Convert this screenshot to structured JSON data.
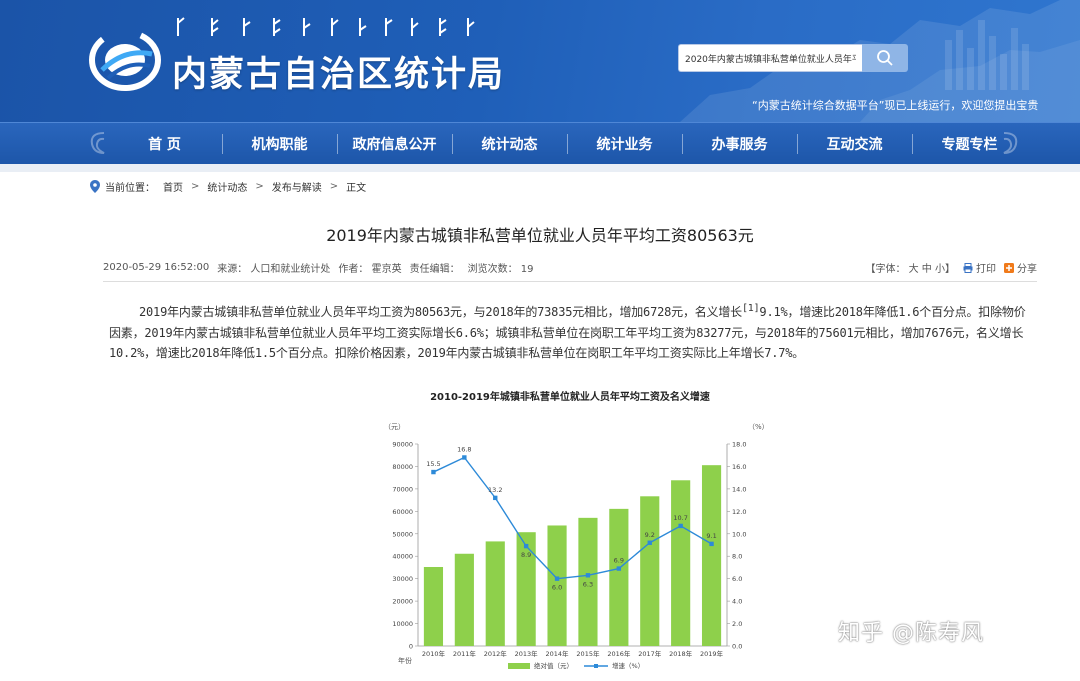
{
  "header": {
    "site_title": "内蒙古自治区统计局",
    "search_value": "2020年内蒙古城镇非私营单位就业人员年平",
    "marquee": "“内蒙古统计综合数据平台”现已上线运行，欢迎您提出宝贵"
  },
  "nav": [
    "首  页",
    "机构职能",
    "政府信息公开",
    "统计动态",
    "统计业务",
    "办事服务",
    "互动交流",
    "专题专栏"
  ],
  "breadcrumb": {
    "label": "当前位置：",
    "items": [
      "首页",
      "统计动态",
      "发布与解读",
      "正文"
    ],
    "sep": ">"
  },
  "article": {
    "title": "2019年内蒙古城镇非私营单位就业人员年平均工资80563元",
    "date": "2020-05-29 16:52:00",
    "source": "来源：  人口和就业统计处",
    "author": "作者：   霍京英",
    "editor": "责任编辑：",
    "views": "浏览次数：  19",
    "font_label": "【字体：  大  中  小】",
    "print_label": "打印",
    "share_label": "分享",
    "para_part1": "2019年内蒙古城镇非私营单位就业人员年平均工资为80563元，与2018年的73835元相比，增加6728元，名义增长",
    "footnote": "[1]",
    "para_part2": "9.1%，增速比2018年降低1.6个百分点。扣除物价因素，2019年内蒙古城镇非私营单位就业人员年平均工资实际增长6.6%；城镇非私营单位在岗职工年平均工资为83277元，与2018年的75601元相比，增加7676元，名义增长10.2%，增速比2018年降低1.5个百分点。扣除价格因素，2019年内蒙古城镇非私营单位在岗职工年平均工资实际比上年增长7.7%。"
  },
  "watermark": "知乎 @陈寿风",
  "colors": {
    "banner": "#1f5fb8",
    "nav": "#2a66bd",
    "bar": "#8ed04b",
    "line": "#2d8ad8"
  },
  "chart_data": {
    "type": "bar",
    "title": "2010-2019年城镇非私营单位就业人员年平均工资及名义增速",
    "categories": [
      "2010年",
      "2011年",
      "2012年",
      "2013年",
      "2014年",
      "2015年",
      "2016年",
      "2017年",
      "2018年",
      "2019年"
    ],
    "x_axis_label": "年份",
    "left_unit": "（元）",
    "right_unit": "（%）",
    "left_ylim": [
      0,
      90000
    ],
    "left_ticks": [
      0,
      10000,
      20000,
      30000,
      40000,
      50000,
      60000,
      70000,
      80000,
      90000
    ],
    "right_ylim": [
      0,
      18
    ],
    "right_ticks": [
      "0.0",
      "2.0",
      "4.0",
      "6.0",
      "8.0",
      "10.0",
      "12.0",
      "14.0",
      "16.0",
      "18.0"
    ],
    "series": [
      {
        "name": "绝对值（元）",
        "type": "bar",
        "values": [
          35200,
          41100,
          46600,
          50700,
          53700,
          57100,
          61100,
          66700,
          73835,
          80563
        ]
      },
      {
        "name": "增速（%）",
        "type": "line",
        "values": [
          15.5,
          16.8,
          13.2,
          8.9,
          6.0,
          6.3,
          6.9,
          9.2,
          10.7,
          9.1
        ],
        "labels": [
          "15.5",
          "16.8",
          "13.2",
          "8.9",
          "6.0",
          "6.3",
          "6.9",
          "9.2",
          "10.7",
          "9.1"
        ]
      }
    ],
    "legend_position": "bottom"
  }
}
